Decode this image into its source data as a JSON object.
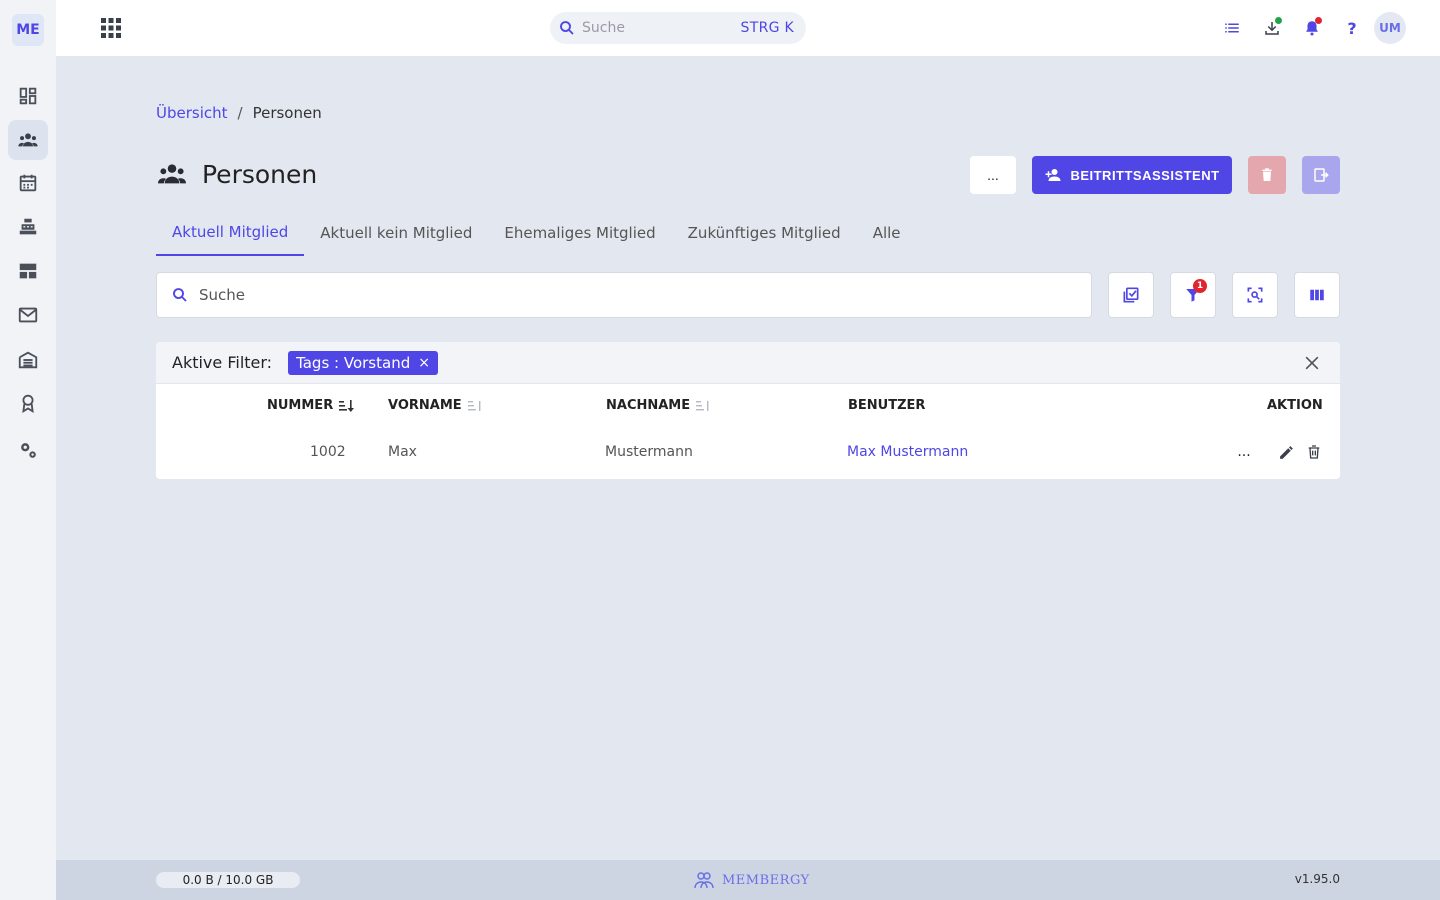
{
  "sidebar": {
    "logo": "ME",
    "items": [
      {
        "name": "dashboard-icon"
      },
      {
        "name": "people-icon"
      },
      {
        "name": "calendar-icon"
      },
      {
        "name": "cash-register-icon"
      },
      {
        "name": "table-icon"
      },
      {
        "name": "mail-icon"
      },
      {
        "name": "warehouse-icon"
      },
      {
        "name": "badge-icon"
      },
      {
        "name": "settings-icon"
      }
    ],
    "active_index": 1
  },
  "topbar": {
    "search_placeholder": "Suche",
    "shortcut": "STRG K",
    "avatar": "UM"
  },
  "breadcrumb": {
    "home": "Übersicht",
    "separator": "/",
    "current": "Personen"
  },
  "page": {
    "title": "Personen",
    "more_label": "...",
    "primary_label": "BEITRITTSASSISTENT"
  },
  "tabs": [
    {
      "label": "Aktuell Mitglied",
      "active": true
    },
    {
      "label": "Aktuell kein Mitglied"
    },
    {
      "label": "Ehemaliges Mitglied"
    },
    {
      "label": "Zukünftiges Mitglied"
    },
    {
      "label": "Alle"
    }
  ],
  "search": {
    "placeholder": "Suche",
    "filter_badge": "1"
  },
  "filters": {
    "label": "Aktive Filter:",
    "chip": "Tags : Vorstand",
    "chip_remove": "×"
  },
  "table": {
    "columns": {
      "nummer": "NUMMER",
      "vorname": "VORNAME",
      "nachname": "NACHNAME",
      "benutzer": "BENUTZER",
      "aktion": "AKTION"
    },
    "rows": [
      {
        "nummer": "1002",
        "vorname": "Max",
        "nachname": "Mustermann",
        "benutzer": "Max Mustermann",
        "more": "..."
      }
    ]
  },
  "footer": {
    "storage": "0.0 B / 10.0 GB",
    "brand": "MEMBERGY",
    "version": "v1.95.0"
  },
  "colors": {
    "accent": "#4f46e5",
    "delete_disabled": "#e4a7ae",
    "export_disabled": "#a9a6ee",
    "badge_red": "#e0252e",
    "status_green": "#22a34a"
  }
}
